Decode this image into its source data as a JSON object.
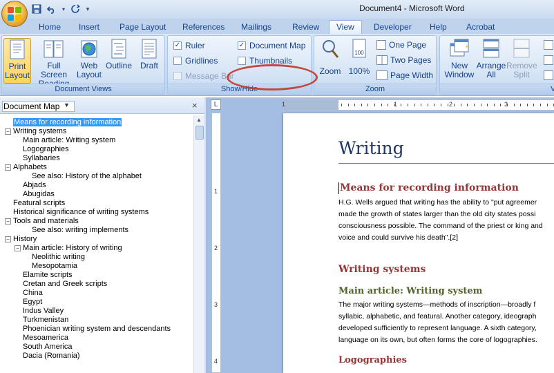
{
  "window": {
    "title": "Document4 - Microsoft Word"
  },
  "qat": {
    "save_icon": "save-icon",
    "undo_icon": "undo-icon",
    "redo_icon": "redo-icon",
    "more_icon": "chevron-down-icon"
  },
  "tabs": [
    {
      "label": "Home"
    },
    {
      "label": "Insert"
    },
    {
      "label": "Page Layout"
    },
    {
      "label": "References"
    },
    {
      "label": "Mailings"
    },
    {
      "label": "Review"
    },
    {
      "label": "View",
      "active": true
    },
    {
      "label": "Developer"
    },
    {
      "label": "Help"
    },
    {
      "label": "Acrobat"
    }
  ],
  "ribbon": {
    "document_views": {
      "label": "Document Views",
      "print_layout": "Print Layout",
      "print_layout_l1": "Print",
      "print_layout_l2": "Layout",
      "full_screen_l1": "Full Screen",
      "full_screen_l2": "Reading",
      "web_l1": "Web",
      "web_l2": "Layout",
      "outline": "Outline",
      "draft": "Draft"
    },
    "show_hide": {
      "label": "Show/Hide",
      "ruler": "Ruler",
      "ruler_checked": true,
      "gridlines": "Gridlines",
      "gridlines_checked": false,
      "message_bar": "Message Bar",
      "message_bar_checked": false,
      "document_map": "Document Map",
      "document_map_checked": true,
      "thumbnails": "Thumbnails",
      "thumbnails_checked": false
    },
    "zoom": {
      "label": "Zoom",
      "zoom": "Zoom",
      "hundred": "100%",
      "hundred_icon_text": "100",
      "one_page": "One Page",
      "two_pages": "Two Pages",
      "page_width": "Page Width"
    },
    "window": {
      "new_window_l1": "New",
      "new_window_l2": "Window",
      "arrange_l1": "Arrange",
      "arrange_l2": "All",
      "remove_split_l1": "Remove",
      "remove_split_l2": "Split",
      "label_partial": "V"
    }
  },
  "docmap": {
    "title": "Document Map",
    "close": "×",
    "items": [
      {
        "text": "Means for recording information",
        "level": 1,
        "toggle": "",
        "selected": true
      },
      {
        "text": "Writing systems",
        "level": 1,
        "toggle": "−"
      },
      {
        "text": "Main article: Writing system",
        "level": 2,
        "toggle": ""
      },
      {
        "text": "Logographies",
        "level": 2,
        "toggle": ""
      },
      {
        "text": "Syllabaries",
        "level": 2,
        "toggle": ""
      },
      {
        "text": "Alphabets",
        "level": 1,
        "toggle": "−"
      },
      {
        "text": "See also: History of the alphabet",
        "level": 3,
        "toggle": ""
      },
      {
        "text": "Abjads",
        "level": 2,
        "toggle": ""
      },
      {
        "text": "Abugidas",
        "level": 2,
        "toggle": ""
      },
      {
        "text": "Featural scripts",
        "level": 1,
        "toggle": ""
      },
      {
        "text": "Historical significance of writing systems",
        "level": 1,
        "toggle": ""
      },
      {
        "text": "Tools and materials",
        "level": 1,
        "toggle": "−"
      },
      {
        "text": "See also: writing implements",
        "level": 3,
        "toggle": ""
      },
      {
        "text": "History",
        "level": 1,
        "toggle": "−"
      },
      {
        "text": "Main article: History of writing",
        "level": 2,
        "toggle": "−"
      },
      {
        "text": "Neolithic writing",
        "level": 3,
        "toggle": ""
      },
      {
        "text": "Mesopotamia",
        "level": 3,
        "toggle": ""
      },
      {
        "text": "Elamite scripts",
        "level": 2,
        "toggle": ""
      },
      {
        "text": "Cretan and Greek scripts",
        "level": 2,
        "toggle": ""
      },
      {
        "text": "China",
        "level": 2,
        "toggle": ""
      },
      {
        "text": "Egypt",
        "level": 2,
        "toggle": ""
      },
      {
        "text": "Indus Valley",
        "level": 2,
        "toggle": ""
      },
      {
        "text": "Turkmenistan",
        "level": 2,
        "toggle": ""
      },
      {
        "text": "Phoenician writing system and descendants",
        "level": 2,
        "toggle": ""
      },
      {
        "text": "Mesoamerica",
        "level": 2,
        "toggle": ""
      },
      {
        "text": "South America",
        "level": 2,
        "toggle": ""
      },
      {
        "text": "Dacia (Romania)",
        "level": 2,
        "toggle": ""
      }
    ]
  },
  "ruler": {
    "corner": "L",
    "h_numbers": [
      "1",
      "1",
      "2",
      "3"
    ],
    "v_numbers": [
      "1",
      "2",
      "3",
      "4"
    ]
  },
  "document": {
    "title": "Writing",
    "h_means": "Means for recording information",
    "p1": [
      "H.G. Wells argued that writing has the ability to \"put agreemer",
      "made the growth of states larger than the old city states possi",
      "consciousness possible. The command of the priest or king and",
      "voice and could survive his death\".[2]"
    ],
    "h_writing_systems": "Writing systems",
    "h_main_article": "Main article: Writing system",
    "p2": [
      "The major writing systems—methods of inscription—broadly f",
      "syllabic, alphabetic, and featural. Another category, ideograph",
      "developed sufficiently to represent language. A sixth category,",
      "language on its own, but often forms the core of logographies."
    ],
    "h_logographies": "Logographies"
  }
}
